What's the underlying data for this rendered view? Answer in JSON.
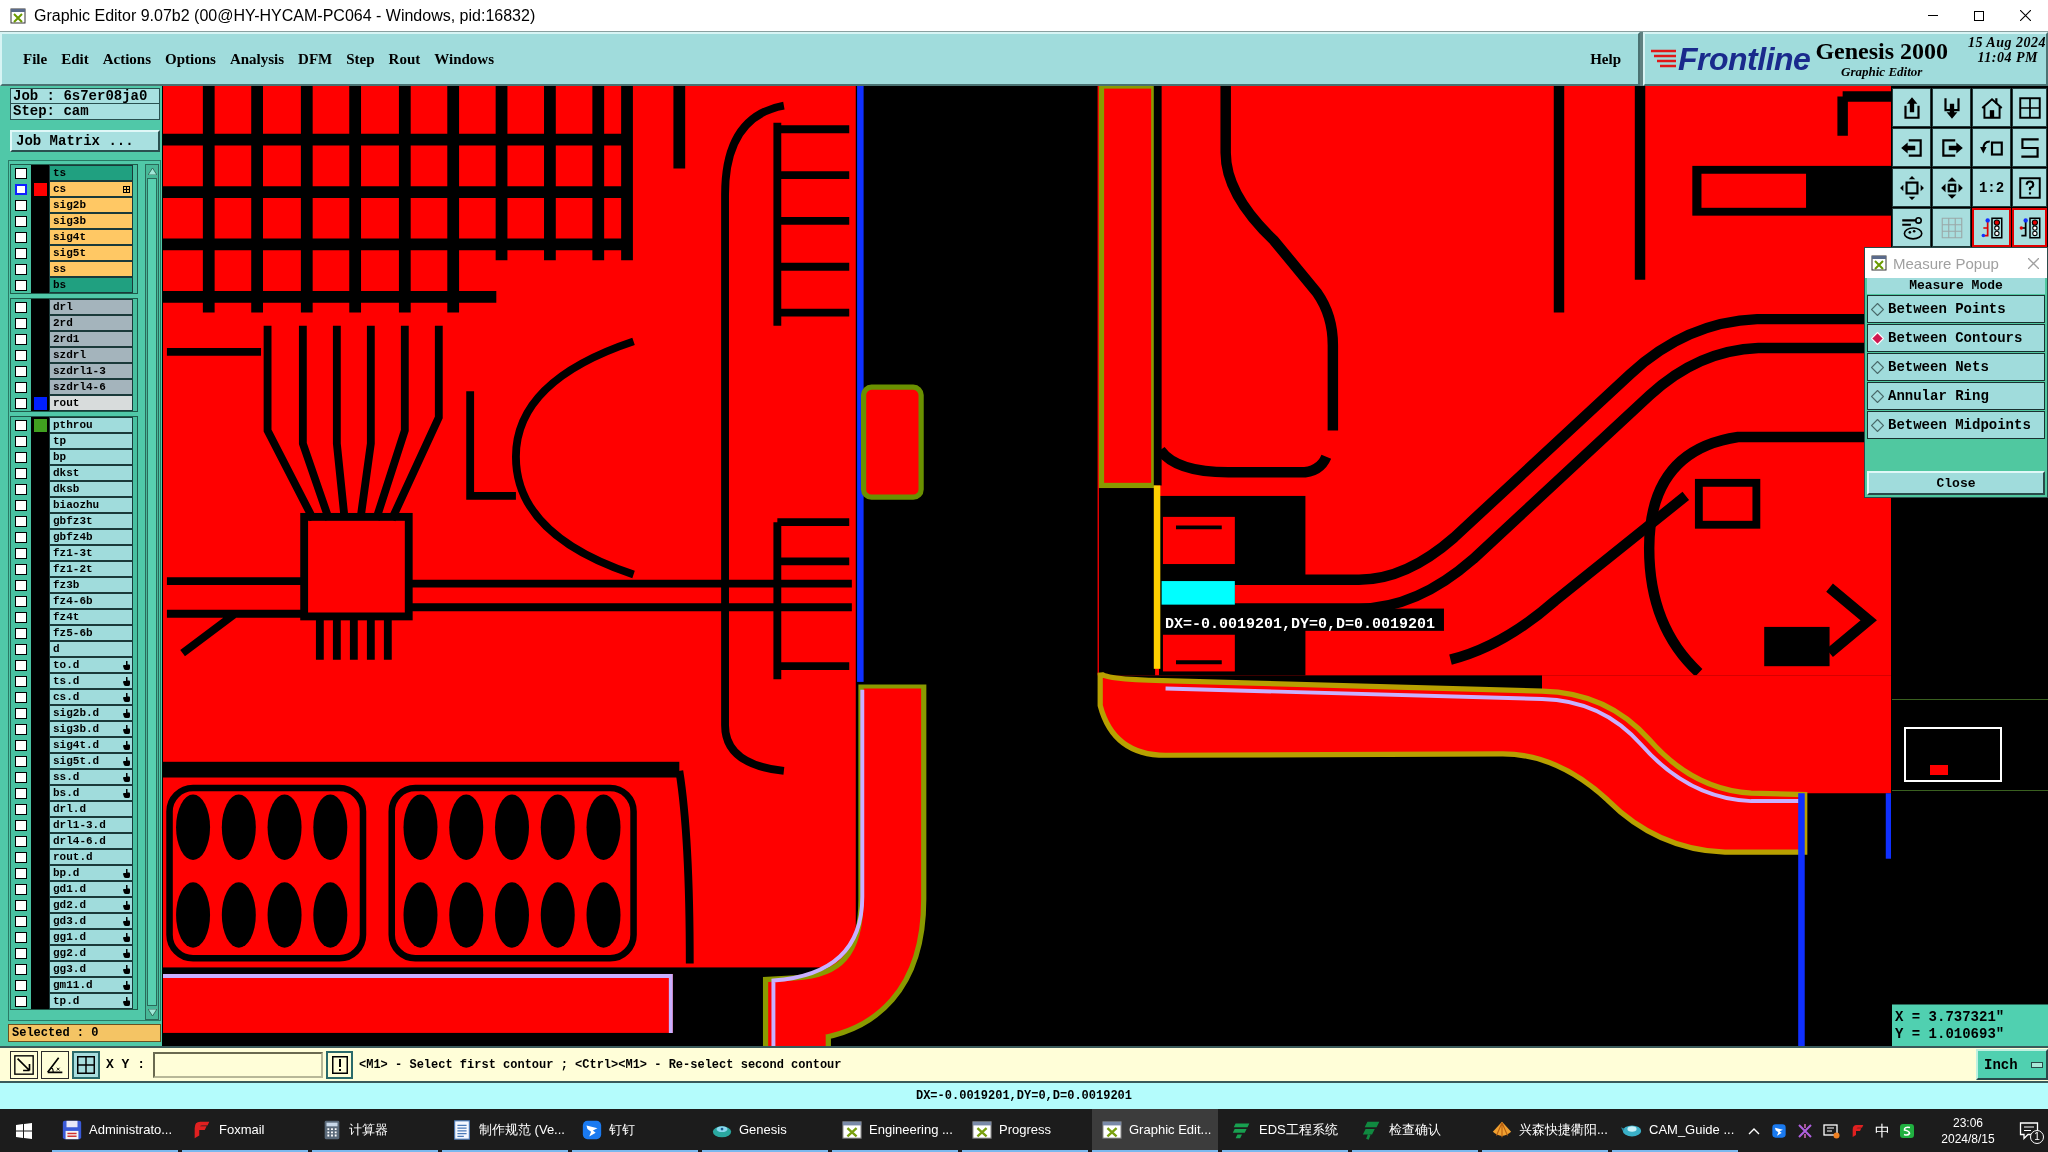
{
  "window": {
    "title": "Graphic Editor 9.07b2 (00@HY-HYCAM-PC064 - Windows, pid:16832)"
  },
  "menu": {
    "items": [
      "File",
      "Edit",
      "Actions",
      "Options",
      "Analysis",
      "DFM",
      "Step",
      "Rout",
      "Windows"
    ],
    "help": "Help"
  },
  "branding": {
    "logo": "Frontline",
    "product": "Genesis 2000",
    "subtitle": "Graphic Editor",
    "date": "15 Aug 2024",
    "time": "11:04 PM"
  },
  "job_panel": {
    "job": "Job : 6s7er08ja0",
    "step": "Step: cam",
    "matrix_button": "Job Matrix ...",
    "selected_count": "Selected : 0"
  },
  "layer_groups": [
    {
      "layers": [
        {
          "name": "ts",
          "kind": "mask",
          "checked": false,
          "selected": false,
          "marked": false
        },
        {
          "name": "cs",
          "kind": "signal",
          "color": "#ff0000",
          "checked": false,
          "selected": true,
          "marked": false
        },
        {
          "name": "sig2b",
          "kind": "signal",
          "checked": false,
          "selected": false,
          "marked": false
        },
        {
          "name": "sig3b",
          "kind": "signal",
          "checked": false,
          "selected": false,
          "marked": false
        },
        {
          "name": "sig4t",
          "kind": "signal",
          "checked": false,
          "selected": false,
          "marked": false
        },
        {
          "name": "sig5t",
          "kind": "signal",
          "checked": false,
          "selected": false,
          "marked": false
        },
        {
          "name": "ss",
          "kind": "signal",
          "checked": false,
          "selected": false,
          "marked": false
        },
        {
          "name": "bs",
          "kind": "mask",
          "checked": false,
          "selected": false,
          "marked": false
        }
      ]
    },
    {
      "layers": [
        {
          "name": "drl",
          "kind": "drill",
          "checked": false,
          "selected": false,
          "marked": false
        },
        {
          "name": "2rd",
          "kind": "drill",
          "checked": false,
          "selected": false,
          "marked": false
        },
        {
          "name": "2rd1",
          "kind": "drill",
          "checked": false,
          "selected": false,
          "marked": false
        },
        {
          "name": "szdrl",
          "kind": "drill",
          "checked": false,
          "selected": false,
          "marked": false
        },
        {
          "name": "szdrl1-3",
          "kind": "drill",
          "checked": false,
          "selected": false,
          "marked": false
        },
        {
          "name": "szdrl4-6",
          "kind": "drill",
          "checked": false,
          "selected": false,
          "marked": false
        },
        {
          "name": "rout",
          "kind": "rout",
          "color": "#0020ff",
          "checked": false,
          "selected": false,
          "marked": false
        }
      ]
    },
    {
      "layers": [
        {
          "name": "pthrou",
          "kind": "misc",
          "color": "#40a020",
          "checked": false,
          "selected": false,
          "marked": false
        },
        {
          "name": "tp",
          "kind": "misc",
          "checked": false,
          "selected": false,
          "marked": false
        },
        {
          "name": "bp",
          "kind": "misc",
          "checked": false,
          "selected": false,
          "marked": false
        },
        {
          "name": "dkst",
          "kind": "misc",
          "checked": false,
          "selected": false,
          "marked": false
        },
        {
          "name": "dksb",
          "kind": "misc",
          "checked": false,
          "selected": false,
          "marked": false
        },
        {
          "name": "biaozhu",
          "kind": "misc",
          "checked": false,
          "selected": false,
          "marked": false
        },
        {
          "name": "gbfz3t",
          "kind": "misc",
          "checked": false,
          "selected": false,
          "marked": false
        },
        {
          "name": "gbfz4b",
          "kind": "misc",
          "checked": false,
          "selected": false,
          "marked": false
        },
        {
          "name": "fz1-3t",
          "kind": "misc",
          "checked": false,
          "selected": false,
          "marked": false
        },
        {
          "name": "fz1-2t",
          "kind": "misc",
          "checked": false,
          "selected": false,
          "marked": false
        },
        {
          "name": "fz3b",
          "kind": "misc",
          "checked": false,
          "selected": false,
          "marked": false
        },
        {
          "name": "fz4-6b",
          "kind": "misc",
          "checked": false,
          "selected": false,
          "marked": false
        },
        {
          "name": "fz4t",
          "kind": "misc",
          "checked": false,
          "selected": false,
          "marked": false
        },
        {
          "name": "fz5-6b",
          "kind": "misc",
          "checked": false,
          "selected": false,
          "marked": false
        },
        {
          "name": "d",
          "kind": "misc",
          "checked": false,
          "selected": false,
          "marked": false
        },
        {
          "name": "to.d",
          "kind": "misc",
          "checked": false,
          "selected": false,
          "marked": true
        },
        {
          "name": "ts.d",
          "kind": "misc",
          "checked": false,
          "selected": false,
          "marked": true
        },
        {
          "name": "cs.d",
          "kind": "misc",
          "checked": false,
          "selected": false,
          "marked": true
        },
        {
          "name": "sig2b.d",
          "kind": "misc",
          "checked": false,
          "selected": false,
          "marked": true
        },
        {
          "name": "sig3b.d",
          "kind": "misc",
          "checked": false,
          "selected": false,
          "marked": true
        },
        {
          "name": "sig4t.d",
          "kind": "misc",
          "checked": false,
          "selected": false,
          "marked": true
        },
        {
          "name": "sig5t.d",
          "kind": "misc",
          "checked": false,
          "selected": false,
          "marked": true
        },
        {
          "name": "ss.d",
          "kind": "misc",
          "checked": false,
          "selected": false,
          "marked": true
        },
        {
          "name": "bs.d",
          "kind": "misc",
          "checked": false,
          "selected": false,
          "marked": true
        },
        {
          "name": "drl.d",
          "kind": "misc",
          "checked": false,
          "selected": false,
          "marked": false
        },
        {
          "name": "drl1-3.d",
          "kind": "misc",
          "checked": false,
          "selected": false,
          "marked": false
        },
        {
          "name": "drl4-6.d",
          "kind": "misc",
          "checked": false,
          "selected": false,
          "marked": false
        },
        {
          "name": "rout.d",
          "kind": "misc",
          "checked": false,
          "selected": false,
          "marked": false
        },
        {
          "name": "bp.d",
          "kind": "misc",
          "checked": false,
          "selected": false,
          "marked": true
        },
        {
          "name": "gd1.d",
          "kind": "misc",
          "checked": false,
          "selected": false,
          "marked": true
        },
        {
          "name": "gd2.d",
          "kind": "misc",
          "checked": false,
          "selected": false,
          "marked": true
        },
        {
          "name": "gd3.d",
          "kind": "misc",
          "checked": false,
          "selected": false,
          "marked": true
        },
        {
          "name": "gg1.d",
          "kind": "misc",
          "checked": false,
          "selected": false,
          "marked": true
        },
        {
          "name": "gg2.d",
          "kind": "misc",
          "checked": false,
          "selected": false,
          "marked": true
        },
        {
          "name": "gg3.d",
          "kind": "misc",
          "checked": false,
          "selected": false,
          "marked": true
        },
        {
          "name": "gm11.d",
          "kind": "misc",
          "checked": false,
          "selected": false,
          "marked": true
        },
        {
          "name": "tp.d",
          "kind": "misc",
          "checked": false,
          "selected": false,
          "marked": true
        }
      ]
    }
  ],
  "canvas": {
    "measurement": "DX=-0.0019201,DY=0,D=0.0019201"
  },
  "toolbar": {
    "buttons": [
      {
        "active": false
      },
      {
        "active": false
      },
      {
        "active": false
      },
      {
        "active": false
      },
      {
        "active": false
      },
      {
        "active": false
      },
      {
        "active": false
      },
      {
        "active": false
      },
      {
        "active": false
      },
      {
        "active": false
      },
      {
        "label": "1:2",
        "active": false
      },
      {
        "active": false
      },
      {
        "active": false
      },
      {
        "active": false
      },
      {
        "active": true
      },
      {
        "active": true
      }
    ]
  },
  "measure_popup": {
    "title": "Measure Popup",
    "heading": "Measure Mode",
    "modes": [
      {
        "label": "Between Points",
        "selected": false
      },
      {
        "label": "Between Contours",
        "selected": true
      },
      {
        "label": "Between Nets",
        "selected": false
      },
      {
        "label": "Annular Ring",
        "selected": false
      },
      {
        "label": "Between Midpoints",
        "selected": false
      }
    ],
    "close_button": "Close"
  },
  "coordinates": {
    "x": "X = 3.737321\"",
    "y": "Y = 1.010693\""
  },
  "command_bar": {
    "prompt": "X Y :",
    "message": "<M1> - Select first contour ; <Ctrl><M1> - Re-select second contour",
    "units": "Inch"
  },
  "status_bar": {
    "text": "DX=-0.0019201,DY=0,D=0.0019201"
  },
  "taskbar": {
    "items": [
      {
        "label": "Administrato...",
        "active": false
      },
      {
        "label": "Foxmail",
        "active": false
      },
      {
        "label": "计算器",
        "active": false
      },
      {
        "label": "制作规范 (Ve...",
        "active": false
      },
      {
        "label": "钉钉",
        "active": false
      },
      {
        "label": "Genesis",
        "active": false
      },
      {
        "label": "Engineering ...",
        "active": false
      },
      {
        "label": "Progress",
        "active": false
      },
      {
        "label": "Graphic Edit...",
        "active": true
      },
      {
        "label": "EDS工程系统",
        "active": false
      },
      {
        "label": "检查确认",
        "active": false
      },
      {
        "label": "兴森快捷衢阳...",
        "active": false
      },
      {
        "label": "CAM_Guide ...",
        "active": false
      }
    ],
    "tray": {
      "ime": "中",
      "time": "23:06",
      "date": "2024/8/15",
      "notifications": "1"
    }
  }
}
